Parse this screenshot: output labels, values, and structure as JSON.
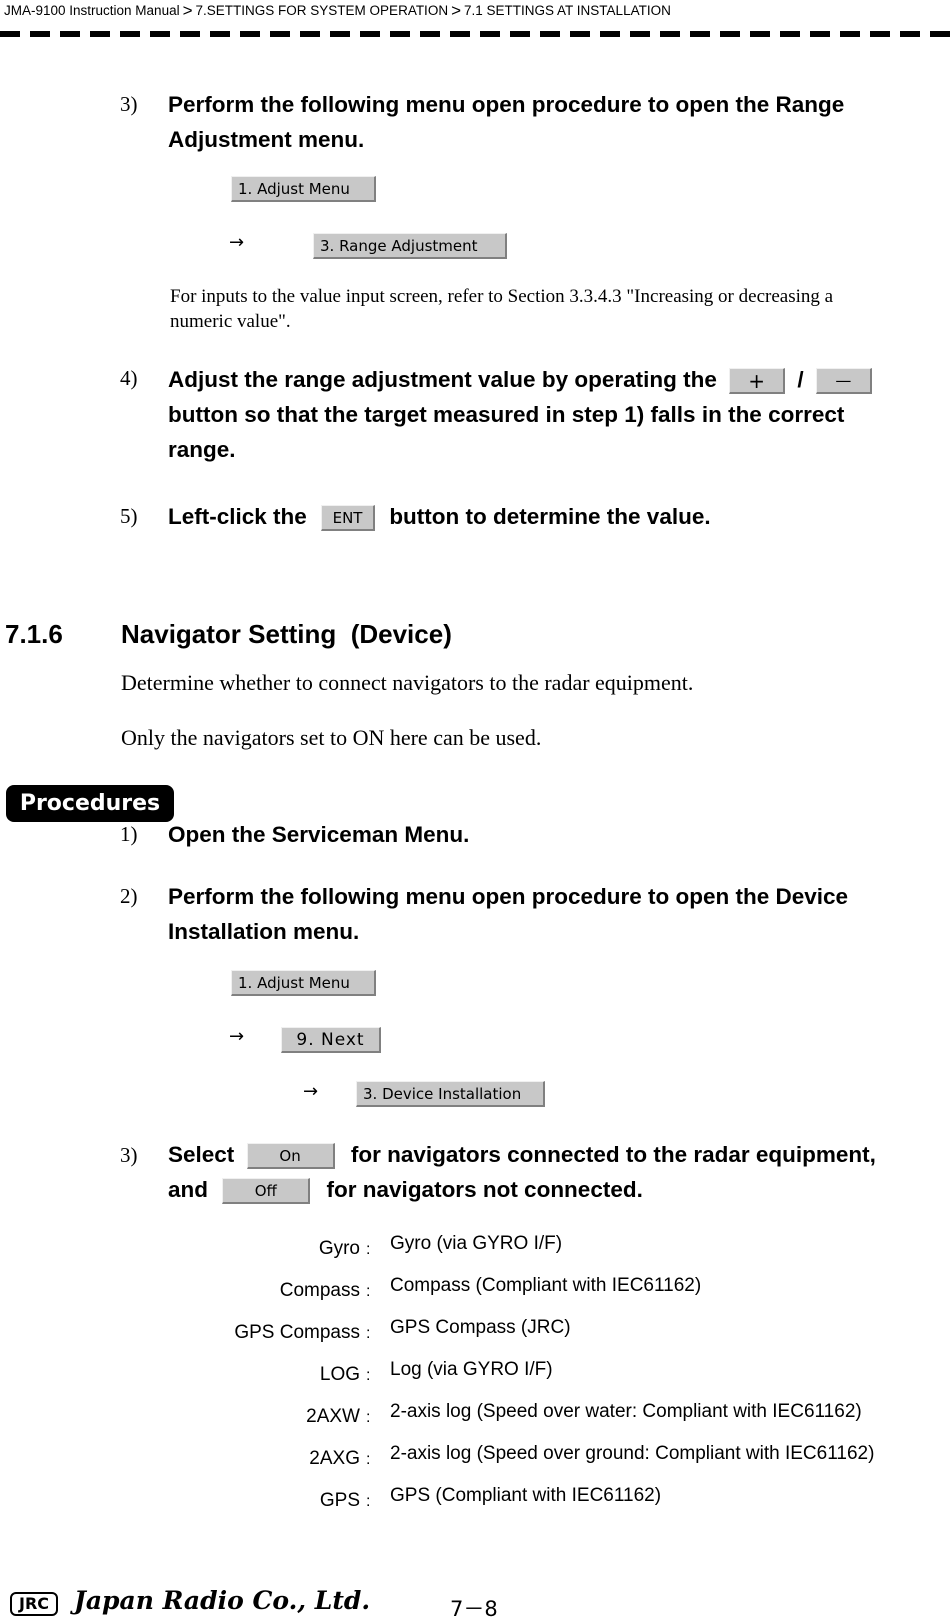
{
  "header": {
    "breadcrumb": [
      "JMA-9100 Instruction Manual",
      "7.SETTINGS FOR SYSTEM OPERATION",
      "7.1  SETTINGS AT INSTALLATION"
    ],
    "separator": ">"
  },
  "range_steps": {
    "step3": {
      "num": "3)",
      "text_line1": "Perform the following menu open procedure to open the Range",
      "text_line2": "Adjustment menu.",
      "menu1": "1. Adjust Menu",
      "arrow": "→",
      "menu2": "3. Range Adjustment",
      "note_line1": "For inputs to the value input screen, refer to Section 3.3.4.3 \"Increasing or decreasing a",
      "note_line2": "numeric value\"."
    },
    "step4": {
      "num": "4)",
      "text_a": "Adjust the range adjustment value by operating the",
      "plus_btn": "+",
      "slash": "/",
      "minus_btn": "—",
      "text_line2": "button so that the target measured in step 1) falls in the correct",
      "text_line3": "range."
    },
    "step5": {
      "num": "5)",
      "text_a": "Left-click the",
      "ent_btn": "ENT",
      "text_b": "button to determine the value."
    }
  },
  "section": {
    "number": "7.1.6",
    "title": "Navigator Setting  (Device)",
    "para1": "Determine whether to connect navigators to the radar equipment.",
    "para2": "Only the navigators set to ON here can be used.",
    "procedures_label": "Procedures"
  },
  "nav_steps": {
    "step1": {
      "num": "1)",
      "text": "Open the Serviceman Menu."
    },
    "step2": {
      "num": "2)",
      "text_line1": "Perform the following menu open procedure to open the Device",
      "text_line2": "Installation menu.",
      "menu1": "1. Adjust Menu",
      "arrow": "→",
      "menu2": "9. Next",
      "menu3": "3. Device Installation"
    },
    "step3": {
      "num": "3)",
      "text_a": "Select",
      "on_btn": "On",
      "text_b": "for navigators connected to the radar equipment,",
      "text_c": "and",
      "off_btn": "Off",
      "text_d": "for navigators not connected."
    }
  },
  "devices": [
    {
      "label": "Gyro",
      "desc": "Gyro (via GYRO I/F)"
    },
    {
      "label": "Compass",
      "desc": "Compass (Compliant with IEC61162)"
    },
    {
      "label": "GPS Compass",
      "desc": "GPS Compass (JRC)"
    },
    {
      "label": "LOG",
      "desc": "Log (via GYRO I/F)"
    },
    {
      "label": "2AXW",
      "desc": "2-axis log (Speed over water: Compliant with IEC61162)"
    },
    {
      "label": "2AXG",
      "desc": "2-axis log (Speed over ground: Compliant with IEC61162)"
    },
    {
      "label": "GPS",
      "desc": "GPS (Compliant with IEC61162)"
    }
  ],
  "device_colon": ":",
  "footer": {
    "logo_box": "JRC",
    "logo_script": "Japan Radio Co., Ltd.",
    "page_number": "7－8"
  }
}
